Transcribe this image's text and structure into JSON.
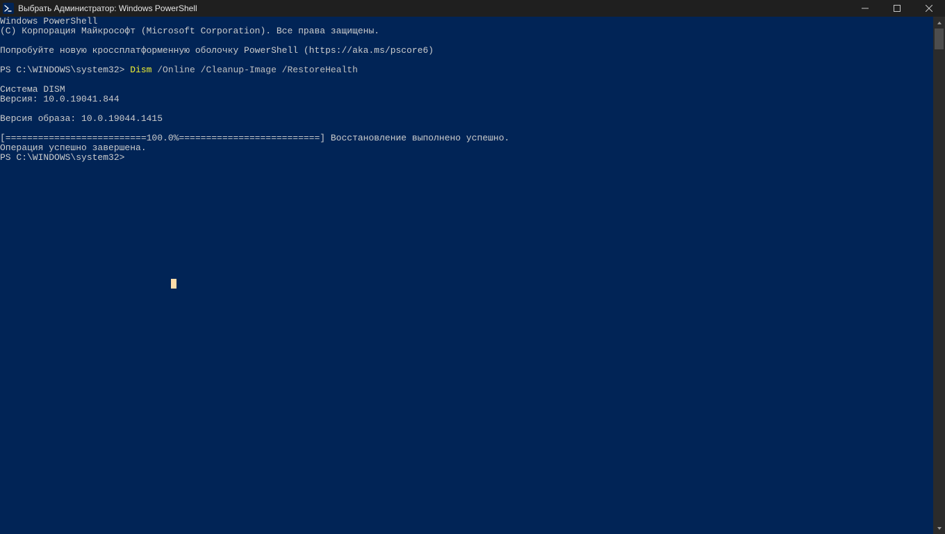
{
  "window": {
    "title": "Выбрать Администратор: Windows PowerShell"
  },
  "terminal": {
    "banner_line1": "Windows PowerShell",
    "banner_line2": "(C) Корпорация Майкрософт (Microsoft Corporation). Все права защищены.",
    "try_line": "Попробуйте новую кроссплатформенную оболочку PowerShell (https://aka.ms/pscore6)",
    "prompt1_prefix": "PS C:\\WINDOWS\\system32> ",
    "command_keyword": "Dism",
    "command_args": " /Online /Cleanup-Image /RestoreHealth",
    "dism_header": "Cистема DISM",
    "dism_version": "Версия: 10.0.19041.844",
    "image_version": "Версия образа: 10.0.19044.1415",
    "progress_line": "[==========================100.0%==========================] Восстановление выполнено успешно.",
    "success_line": "Операция успешно завершена.",
    "prompt2": "PS C:\\WINDOWS\\system32>"
  }
}
